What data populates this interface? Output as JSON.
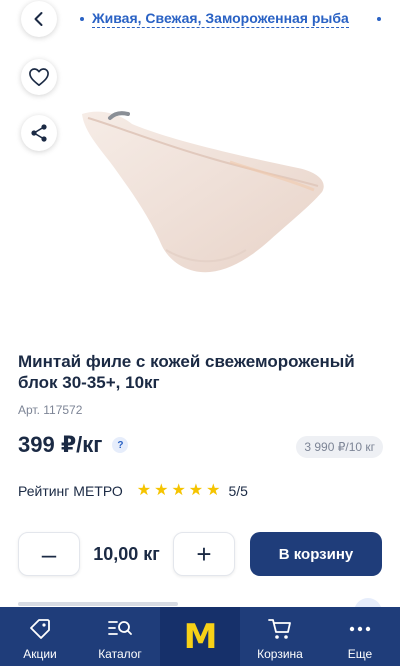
{
  "breadcrumb": {
    "current": "Живая, Свежая, Замороженная рыба"
  },
  "product": {
    "title": "Минтай филе с кожей свежемороженый блок 30-35+, 10кг",
    "article": "Арт. 117572",
    "price": "399 ₽/кг",
    "price_help": "?",
    "unit_price": "3 990 ₽/10 кг",
    "rating_label": "Рейтинг МЕТРО",
    "rating_stars": 5,
    "rating_score": "5/5",
    "image_icon": "fish-fillet-image"
  },
  "quantity": {
    "minus": "–",
    "value": "10,00 кг",
    "plus": "+"
  },
  "cart": {
    "label": "В корзину"
  },
  "tabs": [
    {
      "label": "Акции",
      "icon": "tag-icon"
    },
    {
      "label": "Каталог",
      "icon": "catalog-search-icon"
    },
    {
      "label": "M",
      "icon": "metro-logo"
    },
    {
      "label": "Корзина",
      "icon": "cart-icon"
    },
    {
      "label": "Еще",
      "icon": "more-dots-icon"
    }
  ],
  "colors": {
    "brand_navy": "#1f3d7a",
    "link_blue": "#2a62c4",
    "star_yellow": "#f5c400",
    "metro_yellow": "#f7d117"
  }
}
